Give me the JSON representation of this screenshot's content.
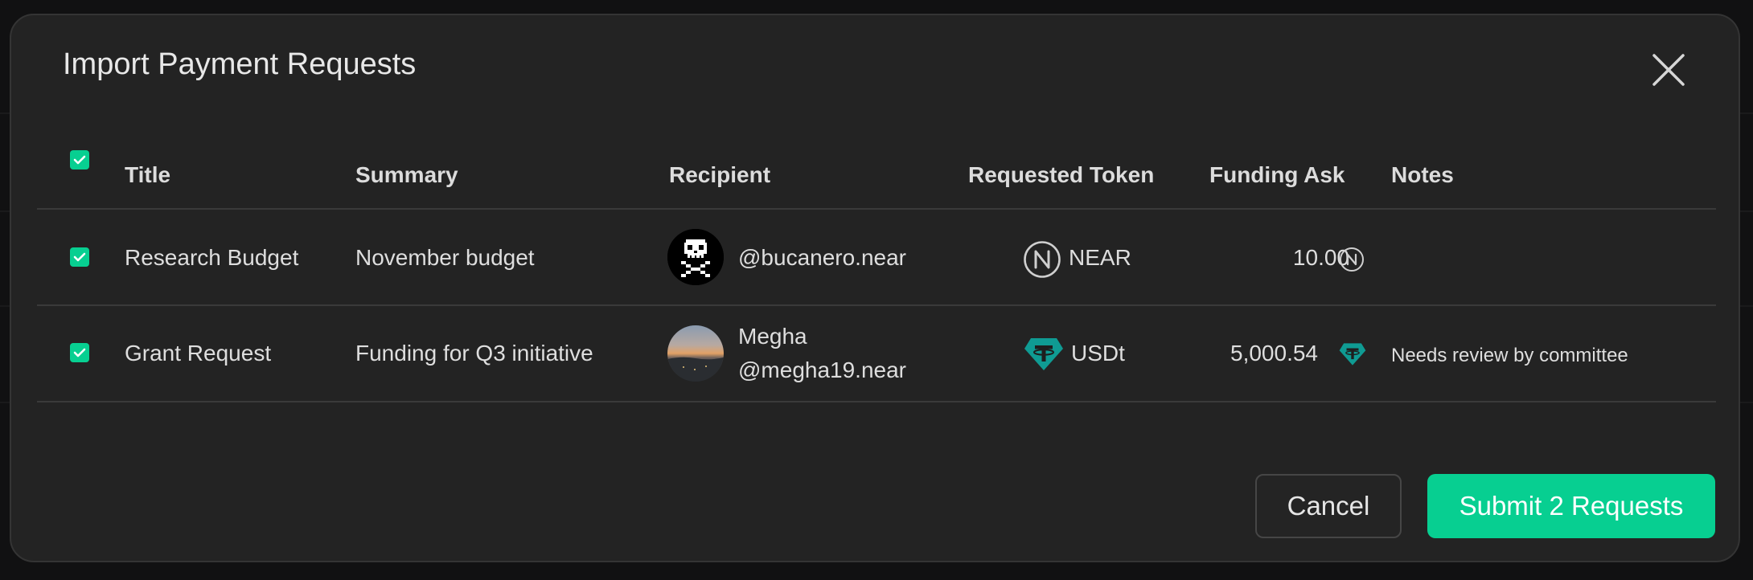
{
  "dialog": {
    "title": "Import Payment Requests"
  },
  "table": {
    "headers": {
      "title": "Title",
      "summary": "Summary",
      "recipient": "Recipient",
      "token": "Requested Token",
      "ask": "Funding Ask",
      "notes": "Notes"
    },
    "select_all_checked": true,
    "rows": [
      {
        "checked": true,
        "title": "Research Budget",
        "summary": "November budget",
        "recipient_name": "",
        "recipient_account": "@bucanero.near",
        "avatar_icon": "pixel-skull-icon",
        "token": "NEAR",
        "token_icon": "near-icon",
        "amount": "10.00",
        "notes": ""
      },
      {
        "checked": true,
        "title": "Grant Request",
        "summary": "Funding for Q3 initiative",
        "recipient_name": "Megha",
        "recipient_account": "@megha19.near",
        "avatar_icon": "sunset-photo-icon",
        "token": "USDt",
        "token_icon": "tether-icon",
        "amount": "5,000.54",
        "notes": "Needs review by committee"
      }
    ]
  },
  "actions": {
    "cancel_label": "Cancel",
    "submit_label": "Submit 2 Requests"
  },
  "colors": {
    "accent": "#07cf91",
    "tether": "#0f9b93",
    "modal_bg": "#232323",
    "backdrop": "#111112"
  }
}
